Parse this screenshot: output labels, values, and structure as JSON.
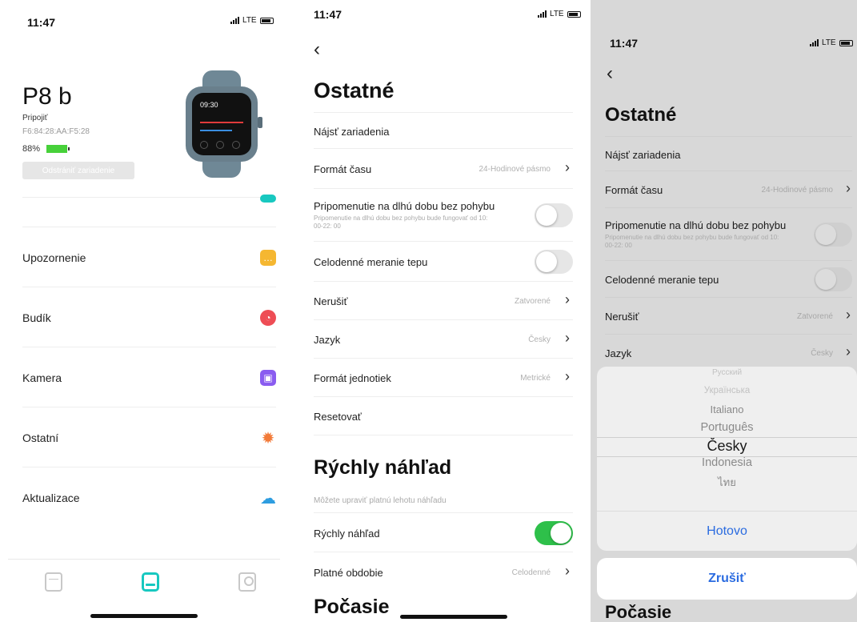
{
  "status": {
    "time": "11:47",
    "network": "LTE"
  },
  "screen1": {
    "device_name": "P8 b",
    "connection_status": "Pripojiť",
    "mac": "F6:84:28:AA:F5:28",
    "battery": "88%",
    "battery_level": 0.88,
    "remove_button": "Odstrániť zariadenie",
    "watch_time": "09:30",
    "menu": [
      {
        "label": "Upozornenie",
        "icon": "message-icon",
        "color": "#f5b731"
      },
      {
        "label": "Budík",
        "icon": "clock-icon",
        "color": "#ee4d55"
      },
      {
        "label": "Kamera",
        "icon": "camera-icon",
        "color": "#8a5cf0"
      },
      {
        "label": "Ostatní",
        "icon": "gear-icon",
        "color": "#f27a38"
      },
      {
        "label": "Aktualizace",
        "icon": "cloud-download-icon",
        "color": "#2e9de0"
      }
    ],
    "tabs": [
      {
        "icon": "phone-icon",
        "active": false
      },
      {
        "icon": "watch-icon",
        "active": true,
        "color": "#18c8c0"
      },
      {
        "icon": "user-icon",
        "active": false
      }
    ]
  },
  "settings": {
    "title": "Ostatné",
    "find_device": "Nájsť zariadenia",
    "time_format_label": "Formát času",
    "time_format_value": "24-Hodinové pásmo",
    "sedentary_label": "Pripomenutie na dlhú dobu bez pohybu",
    "sedentary_sub": "Pripomenutie na dlhú dobu bez pohybu bude fungovať od 10: 00-22: 00",
    "sedentary_on": false,
    "heart_rate_label": "Celodenné meranie tepu",
    "heart_rate_on": false,
    "dnd_label": "Nerušiť",
    "dnd_value": "Zatvorené",
    "language_label": "Jazyk",
    "language_value": "Česky",
    "units_label": "Formát jednotiek",
    "units_value": "Metrické",
    "reset_label": "Resetovať",
    "quick_view_title": "Rýchly náhľad",
    "quick_view_note": "Môžete upraviť platnú lehotu náhľadu",
    "quick_view_label": "Rýchly náhľad",
    "quick_view_on": true,
    "valid_period_label": "Platné obdobie",
    "valid_period_value": "Celodenné",
    "weather_title": "Počasie",
    "toggle_on_color": "#2ec04a"
  },
  "picker": {
    "options": [
      "Русский",
      "Українська",
      "Italiano",
      "Português",
      "Česky",
      "Indonesia",
      "ไทย"
    ],
    "selected": "Česky",
    "done_label": "Hotovo",
    "cancel_label": "Zrušiť",
    "accent": "#2a6be0"
  }
}
